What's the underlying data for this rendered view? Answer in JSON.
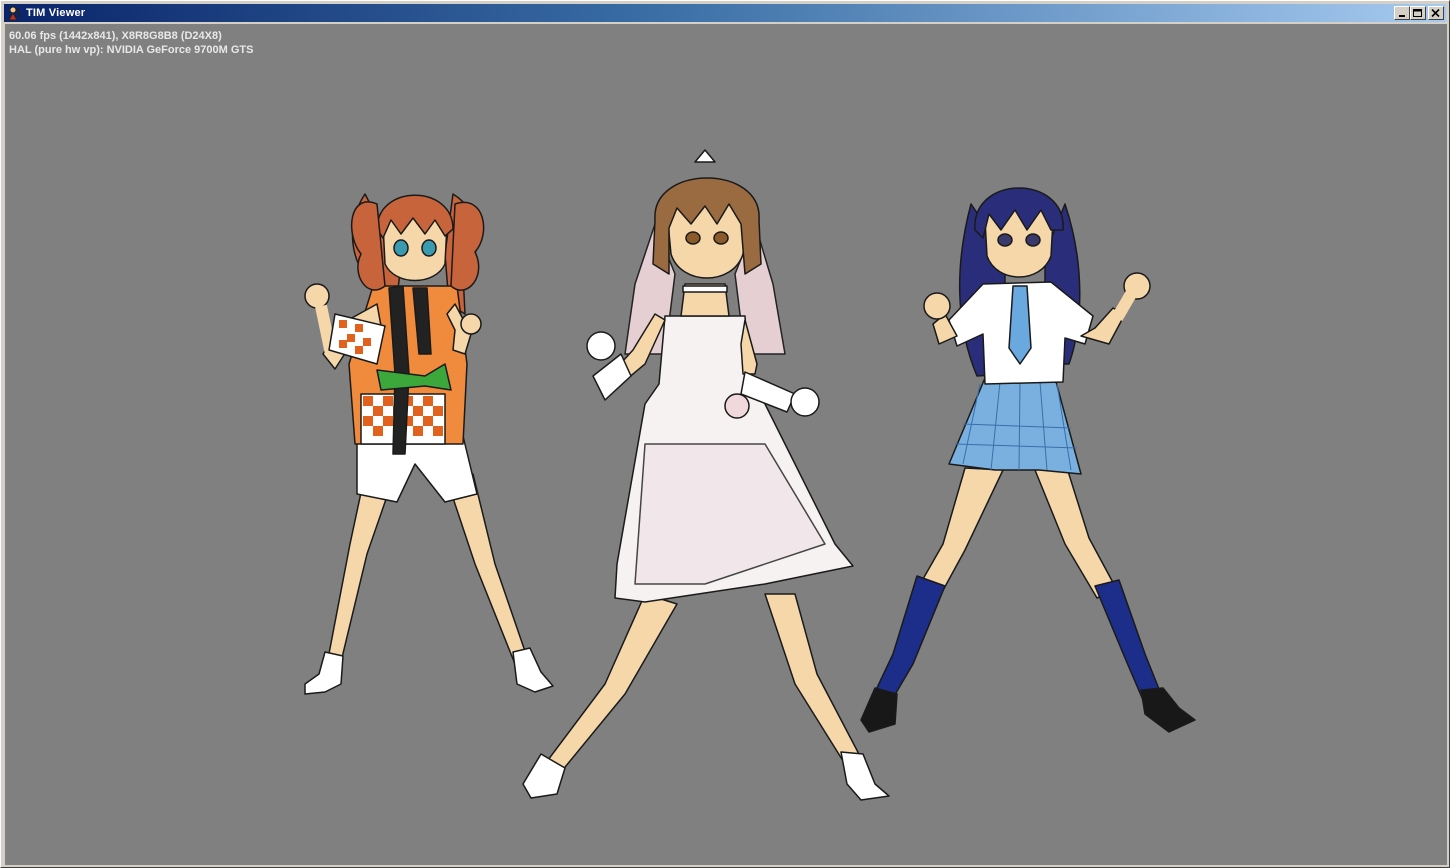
{
  "window": {
    "title": "TIM Viewer",
    "icon": "pencil-figure-icon"
  },
  "titlebar_buttons": [
    {
      "name": "minimize-button",
      "icon": "minimize-icon"
    },
    {
      "name": "maximize-button",
      "icon": "maximize-icon"
    },
    {
      "name": "close-button",
      "icon": "close-icon"
    }
  ],
  "overlay": {
    "fps_line": "60.06 fps (1442x841), X8R8G8B8 (D24X8)",
    "device_line": "HAL (pure hw vp): NVIDIA GeForce 9700M GTS"
  },
  "scene": {
    "background": "#808080",
    "characters": [
      {
        "name": "character-left",
        "hair": "#c8643c",
        "outfit": "#f08a3c",
        "accent": "#3ca83c"
      },
      {
        "name": "character-center",
        "hair": "#9a6a40",
        "outfit": "#f6f2f2",
        "accent": "#f0d8dc"
      },
      {
        "name": "character-right",
        "hair": "#2a2e7a",
        "outfit": "#ffffff",
        "accent": "#7ab0e0"
      }
    ]
  },
  "colors": {
    "titlebar_start": "#0a246a",
    "titlebar_end": "#a6caf0",
    "skin": "#f5d7aa"
  }
}
